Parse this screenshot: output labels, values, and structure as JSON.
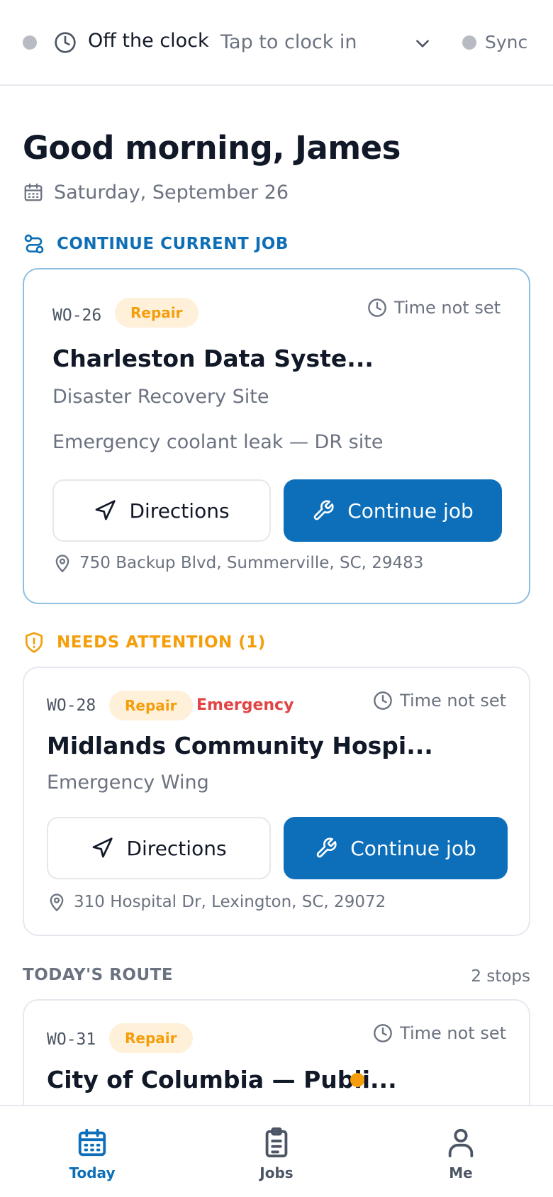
{
  "topbar": {
    "clock_status": "Off the clock",
    "clock_hint": "Tap to clock in",
    "sync_label": "Sync"
  },
  "greeting": "Good morning, James",
  "date": "Saturday, September 26",
  "sections": {
    "current": "CONTINUE CURRENT JOB",
    "attention": "NEEDS ATTENTION (1)",
    "route": "TODAY'S ROUTE",
    "route_count": "2 stops"
  },
  "current_job": {
    "id": "WO-26",
    "type": "Repair",
    "time": "Time not set",
    "title": "Charleston Data Syste...",
    "site": "Disaster Recovery Site",
    "description": "Emergency coolant leak — DR site",
    "directions_label": "Directions",
    "continue_label": "Continue job",
    "address": "750 Backup Blvd, Summerville, SC, 29483"
  },
  "attention_job": {
    "id": "WO-28",
    "type": "Repair",
    "priority": "Emergency",
    "time": "Time not set",
    "title": "Midlands Community Hospi...",
    "site": "Emergency Wing",
    "directions_label": "Directions",
    "continue_label": "Continue job",
    "address": "310 Hospital Dr, Lexington, SC, 29072"
  },
  "route_job": {
    "id": "WO-31",
    "type": "Repair",
    "time": "Time not set",
    "title": "City of Columbia — Publi..."
  },
  "nav": {
    "today": "Today",
    "jobs": "Jobs",
    "me": "Me"
  },
  "colors": {
    "primary": "#0d6fba",
    "attention": "#f59e0b",
    "emergency": "#e24444",
    "badge_bg": "#fef0d9"
  }
}
